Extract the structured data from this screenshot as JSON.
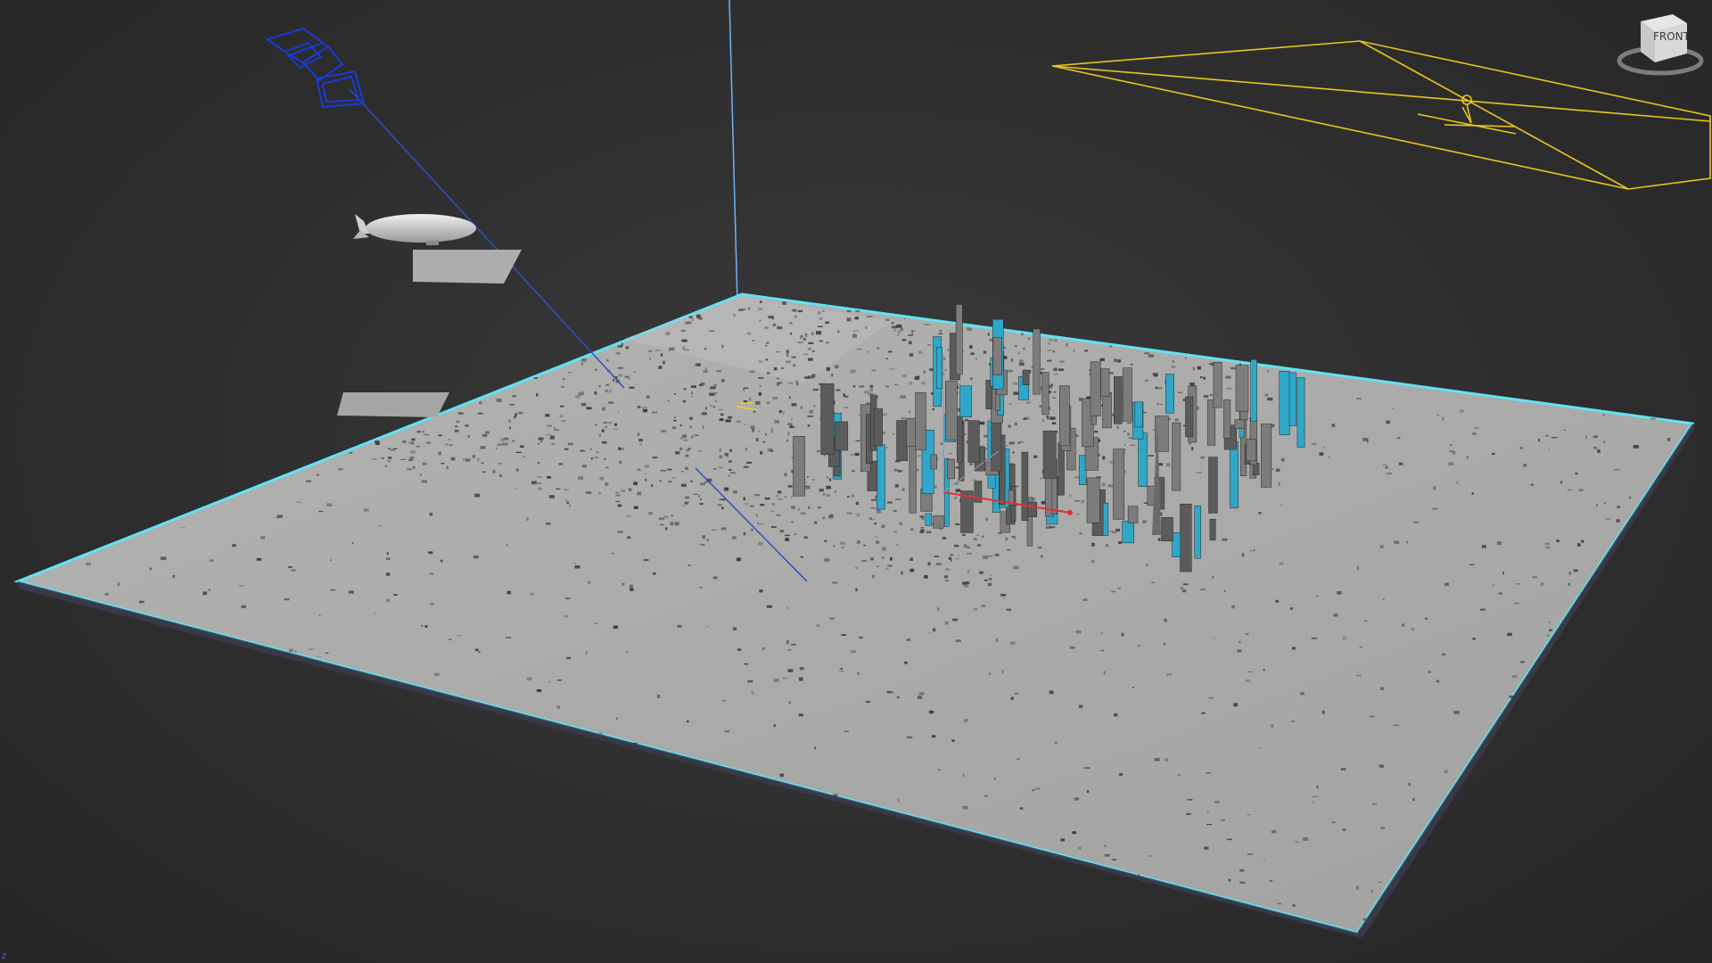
{
  "viewport": {
    "background": "#2e2e2e",
    "selection_color": "#5fe3f5",
    "camera_color": "#1a3ad8",
    "light_color": "#f0d020"
  },
  "viewcube": {
    "face_label": "FRONT",
    "icon": "viewcube-icon"
  },
  "scene_objects": {
    "ground_plane": "city-terrain-plane",
    "camera": "camera-icon",
    "blimp": "blimp-model",
    "target_light": "spotlight-icon",
    "vertical_guide": "light-guide-line"
  },
  "colors": {
    "terrain": "#a9a9a7",
    "buildings_grey": "#5b5b5b",
    "buildings_cyan": "#2fa7c8",
    "grid_pole": "#8aa0b8"
  }
}
